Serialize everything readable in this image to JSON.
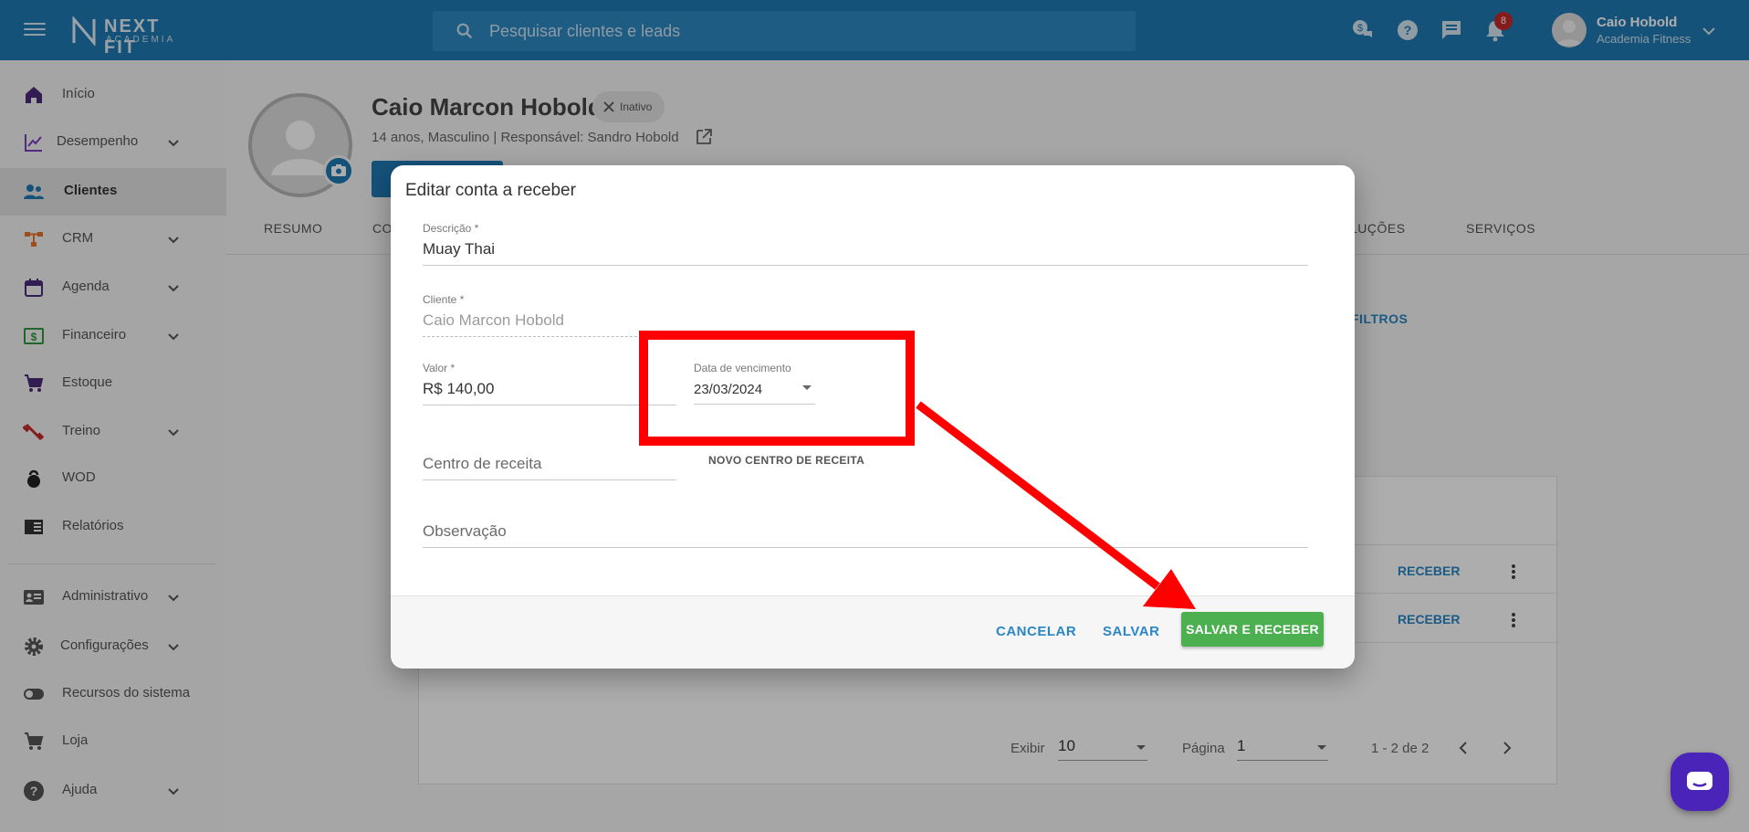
{
  "brand": {
    "name": "NEXT FIT",
    "sub": "ACADEMIA"
  },
  "search": {
    "placeholder": "Pesquisar clientes e leads"
  },
  "notifications": {
    "count": "8"
  },
  "user": {
    "name": "Caio Hobold",
    "company": "Academia Fitness"
  },
  "sidebar": {
    "items": [
      {
        "label": "Início",
        "icon": "home-icon"
      },
      {
        "label": "Desempenho",
        "icon": "chart-line-icon"
      },
      {
        "label": "Clientes",
        "icon": "people-icon"
      },
      {
        "label": "CRM",
        "icon": "crm-icon"
      },
      {
        "label": "Agenda",
        "icon": "calendar-icon"
      },
      {
        "label": "Financeiro",
        "icon": "money-icon"
      },
      {
        "label": "Estoque",
        "icon": "cart-icon"
      },
      {
        "label": "Treino",
        "icon": "dumbbell-icon"
      },
      {
        "label": "WOD",
        "icon": "kettlebell-icon"
      },
      {
        "label": "Relatórios",
        "icon": "report-icon"
      },
      {
        "label": "Administrativo",
        "icon": "id-card-icon"
      },
      {
        "label": "Configurações",
        "icon": "gear-icon"
      },
      {
        "label": "Recursos do sistema",
        "icon": "toggle-icon"
      },
      {
        "label": "Loja",
        "icon": "cart-icon"
      },
      {
        "label": "Ajuda",
        "icon": "help-icon"
      }
    ]
  },
  "profile": {
    "name": "Caio Marcon Hobold",
    "status": "Inativo",
    "meta": "14 anos, Masculino | Responsável: Sandro Hobold"
  },
  "tabs": {
    "resumo": "RESUMO",
    "co": "CO",
    "lucoes": "LUÇÕES",
    "servicos": "SERVIÇOS"
  },
  "filters": {
    "label": "FILTROS"
  },
  "table": {
    "action_label": "RECEBER"
  },
  "pager": {
    "show_label": "Exibir",
    "show_value": "10",
    "page_label": "Página",
    "page_value": "1",
    "count": "1 - 2 de 2"
  },
  "dialog": {
    "title": "Editar conta a receber",
    "descricao": {
      "label": "Descrição *",
      "value": "Muay Thai"
    },
    "cliente": {
      "label": "Cliente *",
      "value": "Caio Marcon Hobold"
    },
    "valor": {
      "label": "Valor *",
      "value": "R$ 140,00"
    },
    "vencimento": {
      "label": "Data de vencimento",
      "value": "23/03/2024"
    },
    "centro": {
      "placeholder": "Centro de receita",
      "action": "NOVO CENTRO DE RECEITA"
    },
    "observacao": {
      "placeholder": "Observação"
    },
    "buttons": {
      "cancel": "CANCELAR",
      "save": "SALVAR",
      "save_receive": "SALVAR E RECEBER"
    }
  },
  "colors": {
    "primary": "#1f79b4",
    "success": "#4caf50",
    "annotation": "#ff0000",
    "chat": "#4a23b8"
  }
}
